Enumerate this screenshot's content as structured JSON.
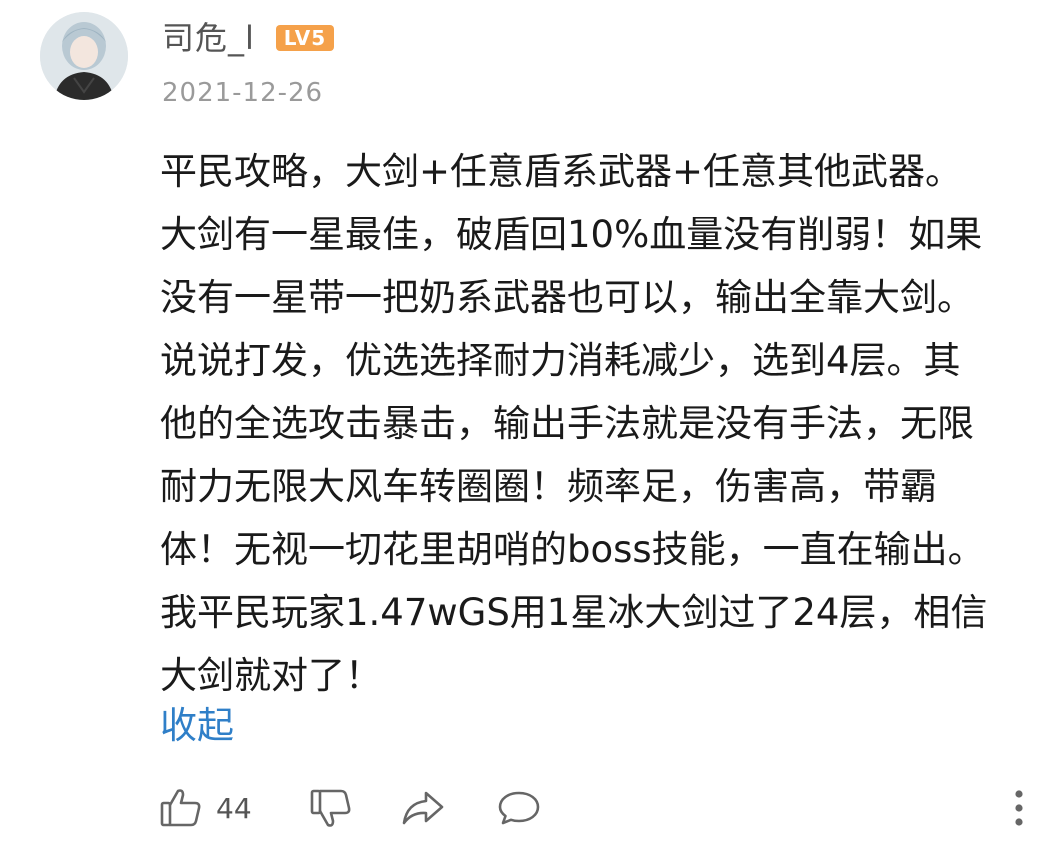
{
  "comment": {
    "username": "司危_l",
    "level_badge": "LV5",
    "date": "2021-12-26",
    "content_lines": [
      "平民攻略，大剑+任意盾系武器+任意其他武器。",
      "大剑有一星最佳，破盾回10%血量没有削弱！如果",
      "没有一星带一把奶系武器也可以，输出全靠大剑。",
      "说说打发，优选选择耐力消耗减少，选到4层。其",
      "他的全选攻击暴击，输出手法就是没有手法，无限",
      "耐力无限大风车转圈圈！频率足，伤害高，带霸",
      "体！无视一切花里胡哨的boss技能，一直在输出。",
      "我平民玩家1.47wGS用1星冰大剑过了24层，相信",
      "大剑就对了！"
    ],
    "collapse_label": "收起"
  },
  "actions": {
    "like_count": "44"
  },
  "colors": {
    "level_badge": "#f5a14a",
    "collapse_link": "#2f7fc8",
    "icon": "#666666"
  }
}
